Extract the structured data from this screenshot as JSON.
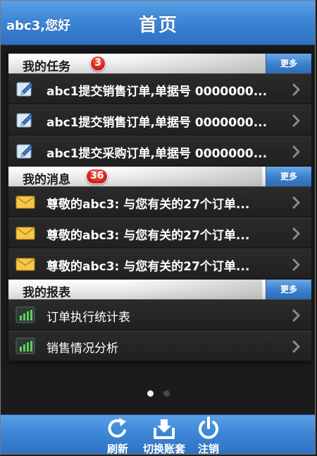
{
  "header": {
    "greeting": "abc3,您好",
    "title": "首页"
  },
  "sections": [
    {
      "title": "我的任务",
      "badge": "3",
      "more_label": "更多",
      "items": [
        {
          "icon": "edit-note-icon",
          "text": "abc1提交销售订单,单据号 0000000..."
        },
        {
          "icon": "edit-note-icon",
          "text": "abc1提交销售订单,单据号 0000000..."
        },
        {
          "icon": "edit-note-icon",
          "text": "abc1提交采购订单,单据号 0000000..."
        }
      ]
    },
    {
      "title": "我的消息",
      "badge": "36",
      "more_label": "更多",
      "items": [
        {
          "icon": "envelope-icon",
          "text": "尊敬的abc3: 与您有关的27个订单..."
        },
        {
          "icon": "envelope-icon",
          "text": "尊敬的abc3: 与您有关的27个订单..."
        },
        {
          "icon": "envelope-icon",
          "text": "尊敬的abc3: 与您有关的27个订单..."
        }
      ]
    },
    {
      "title": "我的报表",
      "more_label": "更多",
      "items": [
        {
          "icon": "bar-chart-icon",
          "text": "订单执行统计表"
        },
        {
          "icon": "bar-chart-icon",
          "text": "销售情况分析"
        }
      ]
    }
  ],
  "pager": {
    "current": 1,
    "total": 2
  },
  "bottombar": {
    "refresh_label": "刷新",
    "switch_label": "切换账套",
    "logout_label": "注销"
  },
  "colors": {
    "accent_blue": "#3d86d6",
    "badge_red": "#d7261a",
    "row_bg": "#252525"
  }
}
